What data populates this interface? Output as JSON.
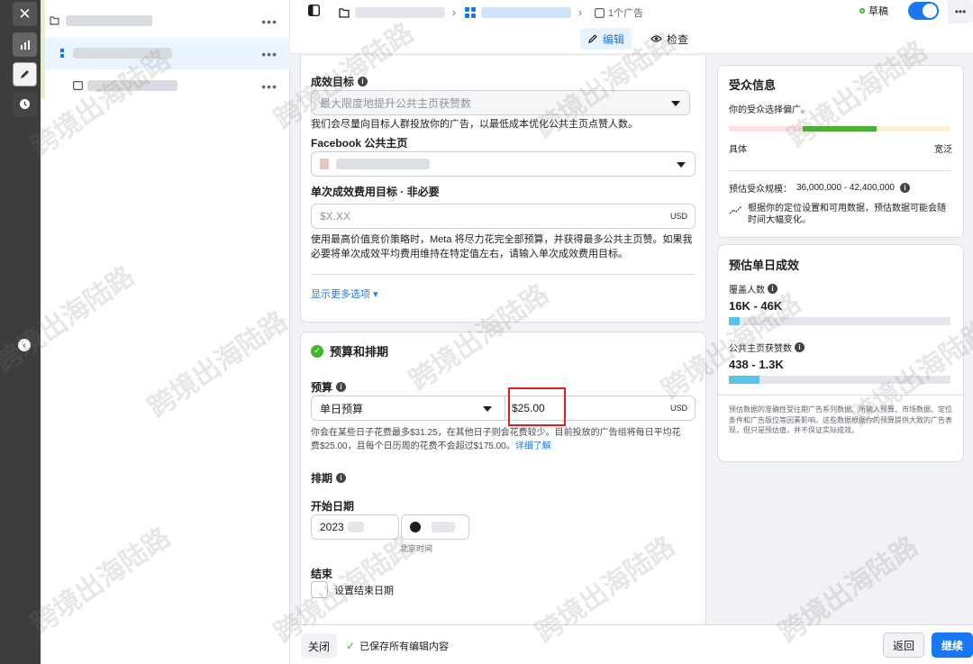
{
  "rail": {
    "icons": [
      "close-icon",
      "chart-icon",
      "pencil-icon",
      "clock-icon",
      "chevron-left-icon"
    ]
  },
  "topbar": {
    "ads_crumb": "1个广告",
    "edit_label": "编辑",
    "check_label": "检查",
    "draft_label": "草稿"
  },
  "goal": {
    "label": "成效目标",
    "select_value": "最大限度地提升公共主页获赞数",
    "help": "我们会尽量向目标人群投放你的广告，以最低成本优化公共主页点赞人数。",
    "page_label": "Facebook 公共主页",
    "cost_label": "单次成效费用目标 · 非必要",
    "cost_placeholder": "$X.XX",
    "cost_currency": "USD",
    "cost_help": "使用最高价值竞价策略时，Meta 将尽力花完全部预算，并获得最多公共主页赞。如果我必要将单次成效平均费用维持在特定值左右，请输入单次成效费用目标。",
    "more_options": "显示更多选项"
  },
  "budget": {
    "section_title": "预算和排期",
    "budget_label": "预算",
    "budget_type": "单日预算",
    "amount": "$25.00",
    "currency": "USD",
    "help_text": "你会在某些日子花费最多$31.25，在其他日子则会花费较少。目前投放的广告组将每日平均花费$25.00，且每个日历周的花费不会超过$175.00。",
    "help_link": "详细了解",
    "schedule_label": "排期",
    "start_label": "开始日期",
    "start_date": "2023",
    "timezone": "北京时间",
    "end_label": "结束",
    "end_checkbox": "设置结束日期"
  },
  "audience": {
    "title": "受众信息",
    "subtitle": "你的受众选择偏广。",
    "specific": "具体",
    "broad": "宽泛",
    "size_label": "预估受众规模：",
    "size_value": "36,000,000 - 42,400,000",
    "note": "根据你的定位设置和可用数据，预估数据可能会随时间大幅变化。"
  },
  "estimates": {
    "title": "预估单日成效",
    "reach_label": "覆盖人数",
    "reach_value": "16K - 46K",
    "reach_fraction": 0.05,
    "likes_label": "公共主页获赞数",
    "likes_value": "438 - 1.3K",
    "likes_fraction": 0.14,
    "disclaimer": "预估数据的准确性受往期广告系列数据、所输入预算、市场数据、定位条件和广告版位等因素影响。这些数据根据你的预算提供大致的广告表现，但只是预估值，并不保证实际成效。"
  },
  "bottombar": {
    "close": "关闭",
    "saved": "已保存所有编辑内容",
    "back": "返回",
    "continue": "继续"
  },
  "watermark": "跨境出海陆路",
  "colors": {
    "accent": "#1877f2",
    "success": "#42b72a",
    "highlight": "#e02020"
  }
}
